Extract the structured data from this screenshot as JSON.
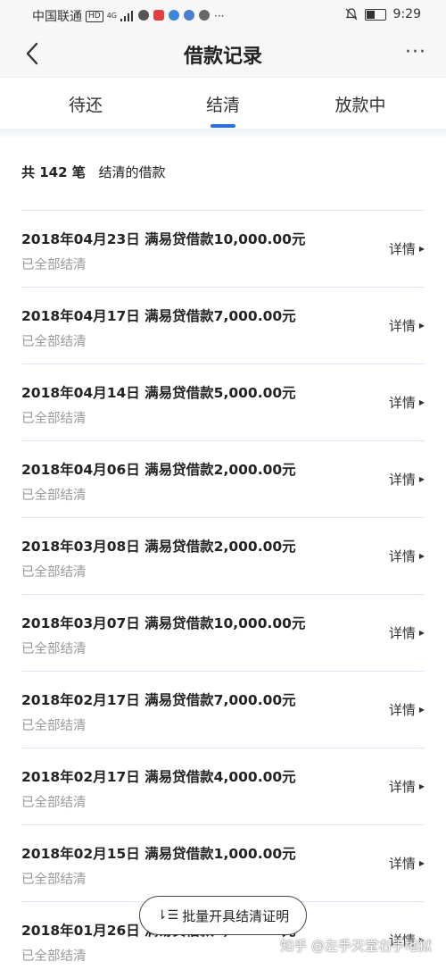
{
  "status_bar": {
    "carrier": "中国联通",
    "hd_badge": "HD",
    "network": "4G",
    "time": "9:29"
  },
  "header": {
    "title": "借款记录",
    "more_label": "···"
  },
  "tabs": [
    {
      "label": "待还"
    },
    {
      "label": "结清"
    },
    {
      "label": "放款中"
    }
  ],
  "summary": {
    "count": "共 142 笔",
    "description": "结清的借款"
  },
  "records": [
    {
      "title": "2018年04月23日 满易贷借款10,000.00元",
      "status": "已全部结清",
      "detail": "详情"
    },
    {
      "title": "2018年04月17日 满易贷借款7,000.00元",
      "status": "已全部结清",
      "detail": "详情"
    },
    {
      "title": "2018年04月14日 满易贷借款5,000.00元",
      "status": "已全部结清",
      "detail": "详情"
    },
    {
      "title": "2018年04月06日 满易贷借款2,000.00元",
      "status": "已全部结清",
      "detail": "详情"
    },
    {
      "title": "2018年03月08日 满易贷借款2,000.00元",
      "status": "已全部结清",
      "detail": "详情"
    },
    {
      "title": "2018年03月07日 满易贷借款10,000.00元",
      "status": "已全部结清",
      "detail": "详情"
    },
    {
      "title": "2018年02月17日 满易贷借款7,000.00元",
      "status": "已全部结清",
      "detail": "详情"
    },
    {
      "title": "2018年02月17日 满易贷借款4,000.00元",
      "status": "已全部结清",
      "detail": "详情"
    },
    {
      "title": "2018年02月15日 满易贷借款1,000.00元",
      "status": "已全部结清",
      "detail": "详情"
    },
    {
      "title": "2018年01月26日 满易贷借款5,000.00元",
      "status": "已全部结清",
      "detail": "详情"
    }
  ],
  "batch_button": {
    "label": "批量开具结清证明"
  },
  "watermark": "知乎 @左手天堂右手地狱",
  "colors": {
    "accent": "#2a6ee6",
    "divider": "#dde6f2",
    "muted_text": "#9a9a9a"
  }
}
